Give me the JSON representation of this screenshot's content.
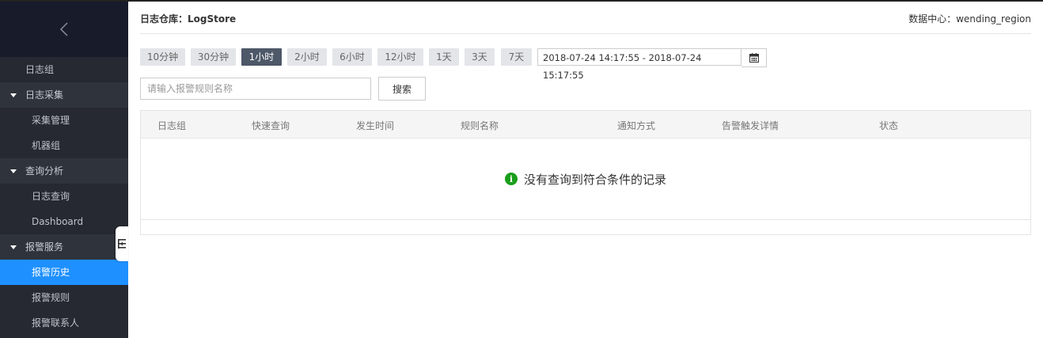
{
  "sidebar": {
    "items": [
      {
        "label": "日志组",
        "kind": "top"
      },
      {
        "label": "日志采集",
        "kind": "group"
      },
      {
        "label": "采集管理",
        "kind": "sub"
      },
      {
        "label": "机器组",
        "kind": "sub"
      },
      {
        "label": "查询分析",
        "kind": "group"
      },
      {
        "label": "日志查询",
        "kind": "sub"
      },
      {
        "label": "Dashboard",
        "kind": "sub"
      },
      {
        "label": "报警服务",
        "kind": "group"
      },
      {
        "label": "报警历史",
        "kind": "sub",
        "active": true
      },
      {
        "label": "报警规则",
        "kind": "sub"
      },
      {
        "label": "报警联系人",
        "kind": "sub"
      }
    ]
  },
  "header": {
    "title_prefix": "日志仓库：",
    "store_name": "LogStore",
    "region": "数据中心：wending_region"
  },
  "time_buttons": [
    {
      "label": "10分钟"
    },
    {
      "label": "30分钟"
    },
    {
      "label": "1小时",
      "active": true
    },
    {
      "label": "2小时"
    },
    {
      "label": "6小时"
    },
    {
      "label": "12小时"
    },
    {
      "label": "1天"
    },
    {
      "label": "3天"
    },
    {
      "label": "7天"
    }
  ],
  "date_range": "2018-07-24 14:17:55 - 2018-07-24 15:17:55",
  "search": {
    "placeholder": "请输入报警规则名称",
    "value": "",
    "button_label": "搜索"
  },
  "table": {
    "columns": [
      "日志组",
      "快速查询",
      "发生时间",
      "规则名称",
      "通知方式",
      "告警触发详情",
      "状态"
    ],
    "empty_text": "没有查询到符合条件的记录"
  },
  "colors": {
    "sidebar_bg": "#262931",
    "active_bg": "#1e90ff",
    "time_button_active": "#4d5868",
    "info_green": "#1a9e1a"
  },
  "icons": {
    "back": "chevron-left-icon",
    "calendar": "calendar-icon",
    "collapse": "sidebar-collapse-icon",
    "info": "info-icon"
  }
}
